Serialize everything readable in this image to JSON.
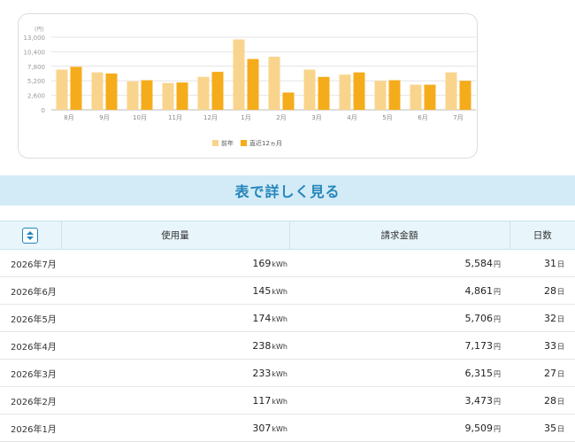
{
  "chart_data": {
    "type": "bar",
    "unit_label": "(円)",
    "categories": [
      "8月",
      "9月",
      "10月",
      "11月",
      "12月",
      "1月",
      "2月",
      "3月",
      "4月",
      "5月",
      "6月",
      "7月"
    ],
    "series": [
      {
        "name": "前年",
        "color": "#f9d48c",
        "values": [
          7200,
          6700,
          5100,
          4800,
          5900,
          12600,
          9500,
          7200,
          6300,
          5200,
          4500,
          6700
        ]
      },
      {
        "name": "直近12ヵ月",
        "color": "#f5ac1b",
        "values": [
          7700,
          6500,
          5300,
          4900,
          6800,
          9100,
          3100,
          5900,
          6700,
          5300,
          4500,
          5200
        ]
      }
    ],
    "yticks": [
      0,
      2600,
      5200,
      7800,
      10400,
      13000
    ],
    "ytick_labels": [
      "0",
      "2,600",
      "5,200",
      "7,800",
      "10,400",
      "13,000"
    ],
    "ylim": [
      0,
      13000
    ],
    "grid": true,
    "legend_position": "bottom-center"
  },
  "band": {
    "title": "表で詳しく見る"
  },
  "table": {
    "headers": {
      "usage": "使用量",
      "amount": "請求金額",
      "days": "日数"
    },
    "sort_icon": "sort-up-down-icon",
    "rows": [
      {
        "period": "2026年7月",
        "usage": "169",
        "usage_unit": "kWh",
        "amount": "5,584",
        "amount_unit": "円",
        "days": "31",
        "days_unit": "日"
      },
      {
        "period": "2026年6月",
        "usage": "145",
        "usage_unit": "kWh",
        "amount": "4,861",
        "amount_unit": "円",
        "days": "28",
        "days_unit": "日"
      },
      {
        "period": "2026年5月",
        "usage": "174",
        "usage_unit": "kWh",
        "amount": "5,706",
        "amount_unit": "円",
        "days": "32",
        "days_unit": "日"
      },
      {
        "period": "2026年4月",
        "usage": "238",
        "usage_unit": "kWh",
        "amount": "7,173",
        "amount_unit": "円",
        "days": "33",
        "days_unit": "日"
      },
      {
        "period": "2026年3月",
        "usage": "233",
        "usage_unit": "kWh",
        "amount": "6,315",
        "amount_unit": "円",
        "days": "27",
        "days_unit": "日"
      },
      {
        "period": "2026年2月",
        "usage": "117",
        "usage_unit": "kWh",
        "amount": "3,473",
        "amount_unit": "円",
        "days": "28",
        "days_unit": "日"
      },
      {
        "period": "2026年1月",
        "usage": "307",
        "usage_unit": "kWh",
        "amount": "9,509",
        "amount_unit": "円",
        "days": "35",
        "days_unit": "日"
      }
    ]
  }
}
